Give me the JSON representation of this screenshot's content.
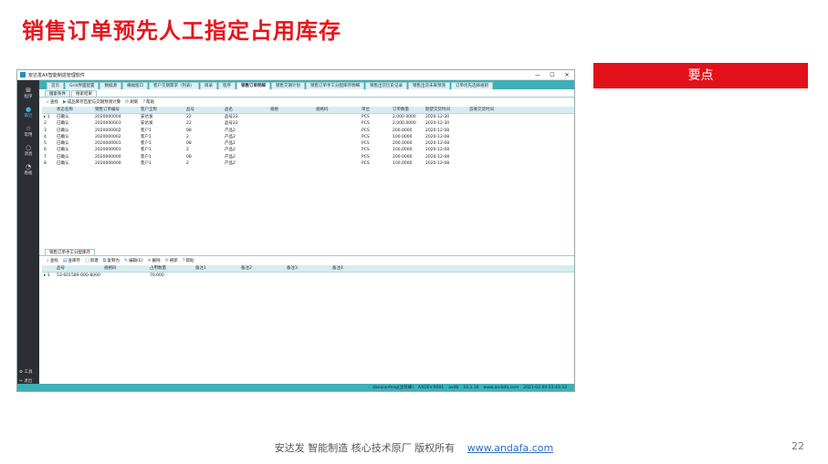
{
  "slide": {
    "title": "销售订单预先人工指定占用库存",
    "keypoint": "要点",
    "footer_text": "安达发   智能制造 核心技术原厂    版权所有",
    "footer_link": "www.andafa.com",
    "page_number": "22"
  },
  "window": {
    "title": "安达发AX智能制造管理软件",
    "controls": [
      "—",
      "☐",
      "✕"
    ]
  },
  "sidebar": {
    "items": [
      {
        "label": "程序",
        "icon": "grid-icon"
      },
      {
        "label": "最近",
        "icon": "clock-icon"
      },
      {
        "label": "常用",
        "icon": "star-icon"
      },
      {
        "label": "消息",
        "icon": "message-icon"
      },
      {
        "label": "看板",
        "icon": "chart-icon"
      }
    ],
    "tools_label": "工具",
    "exit_label": "退出"
  },
  "tabs": [
    "首页",
    "Grid界面配置",
    "数据源",
    "横幅窗口",
    "客户交期需求（列表）",
    "目录",
    "程序",
    "销售订单明细",
    "销售交期计划",
    "销售订单手工分配库存明细",
    "销售出货历史记录",
    "销售出货未来预测",
    "订单优先选择规则"
  ],
  "active_tab_index": 7,
  "upper": {
    "subtabs": [
      "搜索条件",
      "搜索结果"
    ],
    "active_subtab": 1,
    "toolbar": [
      {
        "label": "查找",
        "icon": "search-icon"
      },
      {
        "label": "成品库存匹配与交期预测计算",
        "icon": "play-icon"
      },
      {
        "label": "刷新",
        "icon": "refresh-icon"
      },
      {
        "label": "帮助",
        "icon": "help-icon"
      }
    ],
    "columns": [
      "状态名称",
      "销售订单编号",
      "客户全称",
      "品号",
      "品名",
      "规格",
      "规格码",
      "单位",
      "订单数量",
      "期望交货时间",
      "首要交货时间"
    ],
    "rows": [
      [
        "1",
        "已确认",
        "2020000004",
        "安达发",
        "22",
        "品号22",
        "",
        "",
        "PCS",
        "2,000.0000",
        "2020-12-30",
        ""
      ],
      [
        "2",
        "已确认",
        "2020000003",
        "安达发",
        "22",
        "品号22",
        "",
        "",
        "PCS",
        "2,000.0000",
        "2020-12-30",
        ""
      ],
      [
        "3",
        "已确认",
        "2020000002",
        "客户1",
        "08",
        "产品2",
        "",
        "",
        "PCS",
        "200.0000",
        "2020-12-08",
        ""
      ],
      [
        "4",
        "已确认",
        "2020000002",
        "客户1",
        "2",
        "产品2",
        "",
        "",
        "PCS",
        "100.0000",
        "2020-12-08",
        ""
      ],
      [
        "5",
        "已确认",
        "2020000001",
        "客户1",
        "08",
        "产品2",
        "",
        "",
        "PCS",
        "200.0000",
        "2020-12-08",
        ""
      ],
      [
        "6",
        "已确认",
        "2020000001",
        "客户1",
        "2",
        "产品2",
        "",
        "",
        "PCS",
        "100.0000",
        "2020-12-08",
        ""
      ],
      [
        "7",
        "已确认",
        "2020000000",
        "客户1",
        "08",
        "产品2",
        "",
        "",
        "PCS",
        "200.0000",
        "2020-12-08",
        ""
      ],
      [
        "8",
        "已确认",
        "2020000000",
        "客户1",
        "2",
        "产品2",
        "",
        "",
        "PCS",
        "100.0000",
        "2020-12-08",
        ""
      ]
    ]
  },
  "lower": {
    "subtabs": [
      "销售订单手工分配库存"
    ],
    "toolbar": [
      {
        "label": "查找",
        "icon": "search-icon"
      },
      {
        "label": "查库存",
        "icon": "box-icon"
      },
      {
        "label": "新建",
        "icon": "new-icon"
      },
      {
        "label": "复制为",
        "icon": "copy-icon"
      },
      {
        "label": "编辑(E)",
        "icon": "edit-icon"
      },
      {
        "label": "删除",
        "icon": "delete-icon"
      },
      {
        "label": "刷新",
        "icon": "refresh-icon"
      },
      {
        "label": "帮助",
        "icon": "help-icon"
      }
    ],
    "columns": [
      "品号",
      "规格码",
      "占用数量",
      "备注1",
      "备注2",
      "备注3",
      "备注4"
    ],
    "rows": [
      [
        "1",
        "53-601589-000-8000",
        "",
        "70.000",
        "",
        "",
        "",
        ""
      ]
    ]
  },
  "statusbar": [
    "danxianfeng(沈贤峰)",
    "AXDEV:9001",
    "axdb",
    "10.2.16",
    "www.andafa.com",
    "2021-02-04 03:43:33"
  ]
}
